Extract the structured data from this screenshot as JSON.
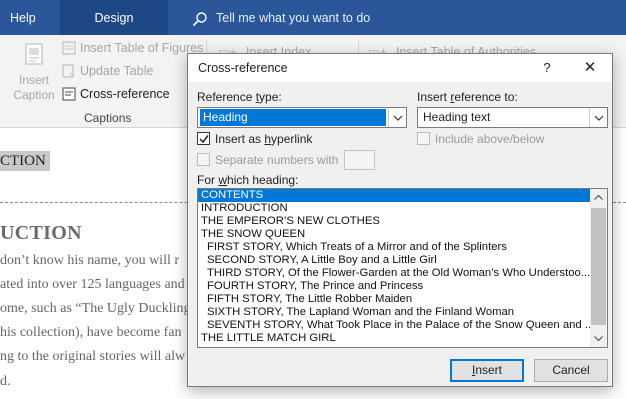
{
  "ribbon": {
    "tabs": [
      {
        "label": "Help"
      },
      {
        "label": "Design"
      }
    ],
    "tell_me": "Tell me what you want to do",
    "insert_caption": "Insert Caption",
    "insert_table_of_figures": "Insert Table of Figures",
    "update_table": "Update Table",
    "cross_reference": "Cross-reference",
    "captions_group": "Captions",
    "insert_index": "Insert Index",
    "insert_table_of_authorities": "Insert Table of Authorities"
  },
  "document": {
    "selected_text": "CTION",
    "heading": "UCTION",
    "lines": [
      "don’t know his name, you will r",
      "ated into over 125 languages and",
      "ome, such as “The Ugly Duckling",
      "his collection), have become fan",
      "ng to the original stories will alw",
      "d."
    ]
  },
  "dialog": {
    "title": "Cross-reference",
    "help": "?",
    "close": "✕",
    "reference_type_label": "Reference type:",
    "reference_type_value": "Heading",
    "insert_reference_to_label": "Insert reference to:",
    "insert_reference_to_value": "Heading text",
    "insert_as_hyperlink": "Insert as hyperlink",
    "insert_as_hyperlink_checked": true,
    "include_above_below": "Include above/below",
    "separate_numbers_with": "Separate numbers with",
    "for_which_heading_label": "For which heading:",
    "headings": [
      {
        "text": "CONTENTS",
        "level": 1,
        "selected": true
      },
      {
        "text": "INTRODUCTION",
        "level": 1
      },
      {
        "text": "THE EMPEROR’S NEW CLOTHES",
        "level": 1
      },
      {
        "text": "THE SNOW QUEEN",
        "level": 1
      },
      {
        "text": "FIRST STORY, Which Treats of a Mirror and of the Splinters",
        "level": 2
      },
      {
        "text": "SECOND STORY, A Little Boy and a Little Girl",
        "level": 2
      },
      {
        "text": "THIRD STORY, Of the Flower-Garden at the Old Woman’s Who Understoo...",
        "level": 2
      },
      {
        "text": "FOURTH STORY, The Prince and Princess",
        "level": 2
      },
      {
        "text": "FIFTH STORY, The Little Robber Maiden",
        "level": 2
      },
      {
        "text": "SIXTH STORY, The Lapland Woman and the Finland Woman",
        "level": 2
      },
      {
        "text": "SEVENTH STORY, What Took Place in the Palace of the Snow Queen and ...",
        "level": 2
      },
      {
        "text": "THE LITTLE MATCH GIRL",
        "level": 1
      }
    ],
    "insert_button": "Insert",
    "cancel_button": "Cancel"
  },
  "colors": {
    "ribbon_blue": "#2b579a",
    "selection_blue": "#0078d7"
  }
}
